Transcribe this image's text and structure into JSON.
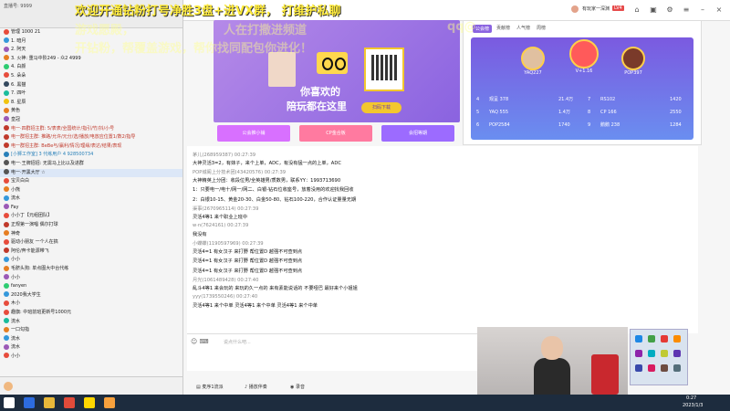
{
  "overlay": {
    "line1": "欢迎开通钻粉打号净胜3盘+进VX群，    打维护私聊",
    "line2a": "游戏愿殿，",
    "line2b": "人在打撒进频道",
    "line2c": "qq@",
    "line3": "开钻粉，帮覆盖游戏，帮你找同配包你进化！",
    "color": "#ffeb3b"
  },
  "sidebar": {
    "title": "直播号: 9999",
    "rows": [
      {
        "label": "管理 1000 21",
        "color": "#e74c3c"
      },
      {
        "label": "1.  暗月",
        "color": "#3498db"
      },
      {
        "label": "2.  阿天",
        "color": "#9b59b6"
      },
      {
        "label": "3.  火神: 重马中阶249 - 众2 4999",
        "color": "#e67e22"
      },
      {
        "label": "4.  白颜",
        "color": "#2ecc71"
      },
      {
        "label": "5.  朵朵",
        "color": "#e74c3c"
      },
      {
        "label": "6.  黑猫",
        "color": "#34495e"
      },
      {
        "label": "7.  四叶",
        "color": "#1abc9c"
      },
      {
        "label": "8.  星辰",
        "color": "#f1c40f"
      },
      {
        "label": "黄色",
        "color": "#e67e22"
      },
      {
        "label": "皇冠",
        "color": "#9b59b6"
      },
      {
        "label": "电一·四群招主群: 5/表表/全国统计/指引/竹/抖/小号",
        "color": "#c0392b"
      },
      {
        "label": "电一群招主群: 推路/允许/元分/选/播放/电放应位置1/数2/指导",
        "color": "#c0392b"
      },
      {
        "label": "电一群招主群: BeBe与/赢利/情况/理缘/表达/结果/表现",
        "color": "#c0392b"
      },
      {
        "label": "[小狮工作室] 3 代练用户 4 928500734",
        "color": "#2980b9"
      },
      {
        "label": "电一·王牌招招: 无需马上比以及进群",
        "color": "#555"
      },
      {
        "label": "电一·开黑大厅 ☆",
        "color": "#555"
      },
      {
        "label": "宝贝白白",
        "color": "#e74c3c"
      },
      {
        "label": "小熊",
        "color": "#e67e22"
      },
      {
        "label": "流水",
        "color": "#3498db"
      },
      {
        "label": "Fay",
        "color": "#9b59b6"
      },
      {
        "label": "小小丁【元组团队】",
        "color": "#e74c3c"
      },
      {
        "label": "正规第一演唱 偶尔打球",
        "color": "#c0392b"
      },
      {
        "label": "神奇",
        "color": "#e67e22"
      },
      {
        "label": "驱动小朋友 一个人在搞",
        "color": "#e74c3c"
      },
      {
        "label": "阿伦/奔卡能源带飞",
        "color": "#c0392b"
      },
      {
        "label": "小小",
        "color": "#3498db"
      },
      {
        "label": "毛脐头狗: 单点图大中台代练",
        "color": "#e67e22"
      },
      {
        "label": "小小",
        "color": "#9b59b6"
      },
      {
        "label": "fanyen",
        "color": "#2ecc71"
      },
      {
        "label": "2020我大学生",
        "color": "#3498db"
      },
      {
        "label": "木小",
        "color": "#e74c3c"
      },
      {
        "label": "趣旗: 中班前班更新号1000元",
        "color": "#e74c3c"
      },
      {
        "label": "流水",
        "color": "#1abc9c"
      },
      {
        "label": "一口勾指",
        "color": "#e67e22"
      },
      {
        "label": "流水",
        "color": "#3498db"
      },
      {
        "label": "流水",
        "color": "#9b59b6"
      },
      {
        "label": "小小",
        "color": "#e74c3c"
      }
    ]
  },
  "banner": {
    "slogan1": "你喜欢的",
    "slogan2": "陪玩都在这里",
    "scan": "扫码下载"
  },
  "sub_buttons": [
    {
      "label": "公会推小铺",
      "color": "#d870ff"
    },
    {
      "label": "CP金合板",
      "color": "#ff7aa0"
    },
    {
      "label": "会招等期",
      "color": "#9c6bff"
    }
  ],
  "top_bar": {
    "user": "有玩家一深渊",
    "level": "LV4"
  },
  "rank": {
    "tabs": [
      "公会榜",
      "贡献榜",
      "人气榜",
      "周榜"
    ],
    "top3": [
      {
        "name": "YAQ227",
        "rank": "2"
      },
      {
        "name": "V+1.16",
        "rank": "1"
      },
      {
        "name": "POP397",
        "rank": "3"
      }
    ],
    "rows": [
      {
        "no": "4",
        "name": "观呈 378",
        "val": "21.4万"
      },
      {
        "no": "5",
        "name": "YAQ 555",
        "val": "1.4万"
      },
      {
        "no": "6",
        "name": "POP2584",
        "val": "1740"
      },
      {
        "no": "7",
        "name": "RS102",
        "val": "1420"
      },
      {
        "no": "8",
        "name": "CP 166",
        "val": "2550"
      },
      {
        "no": "9",
        "name": "鹅鹅 238",
        "val": "1284"
      }
    ]
  },
  "chat": [
    {
      "type": "meta",
      "text": "茅儿(268959387)  00:27:39"
    },
    {
      "type": "body",
      "text": "大神灵活3=2，有妹子，来个上单，ADC，有没有猛一点的上单，ADC"
    },
    {
      "type": "meta",
      "text": "POP城阁上分技术团(43420576)  00:27:39"
    },
    {
      "type": "body",
      "text": "大神精英上分团：收段位男/全英雄男/质数男，联系YY：1993713690"
    },
    {
      "type": "body",
      "text": "1：只要电一/电十/网一/网二、白银-钻石位收座号，放着没用的欢迎找我回收"
    },
    {
      "type": "body",
      "text": "2：白银10-15、黄金20-30、白金50-80、钻石100-220，合作认证量量无期"
    },
    {
      "type": "meta",
      "text": "渠事(2670965114)  00:27:39"
    },
    {
      "type": "body",
      "text": "灵活4等1 来个职业上班中"
    },
    {
      "type": "meta",
      "text": "w·n(7624161)  00:27:39"
    },
    {
      "type": "body",
      "text": "我没有"
    },
    {
      "type": "meta",
      "text": "小蝶蝶(1190597969)  00:27:39"
    },
    {
      "type": "body",
      "text": "灵活4=1 有女汉子 来打野  帮位置D 越强不可查到点"
    },
    {
      "type": "body",
      "text": "灵活4=1 有女汉子 来打野  帮位置D 越强不可查到点"
    },
    {
      "type": "body",
      "text": "灵活4=1 有女汉子 来打野  帮位置D 越强不可查到点"
    },
    {
      "type": "meta",
      "text": "月光(1061489428)  00:27:40"
    },
    {
      "type": "body",
      "text": "乱斗4等1 来会玩的 来玩的久一点的 来有素能说话的 不要哑巴 最好来个小姐姐"
    },
    {
      "type": "meta",
      "text": "yyy(1739550246)  00:27:40"
    },
    {
      "type": "body",
      "text": "灵活4等1   来个中单        灵活4等1   来个中单        灵活4等1   来个中单"
    }
  ],
  "input": {
    "placeholder": "说点什么吧..."
  },
  "bottom_actions": [
    {
      "label": "麦序1流派"
    },
    {
      "label": "播放伴奏"
    },
    {
      "label": "录音"
    }
  ],
  "clock": {
    "time": "0:27",
    "date": "2023/1/3"
  }
}
